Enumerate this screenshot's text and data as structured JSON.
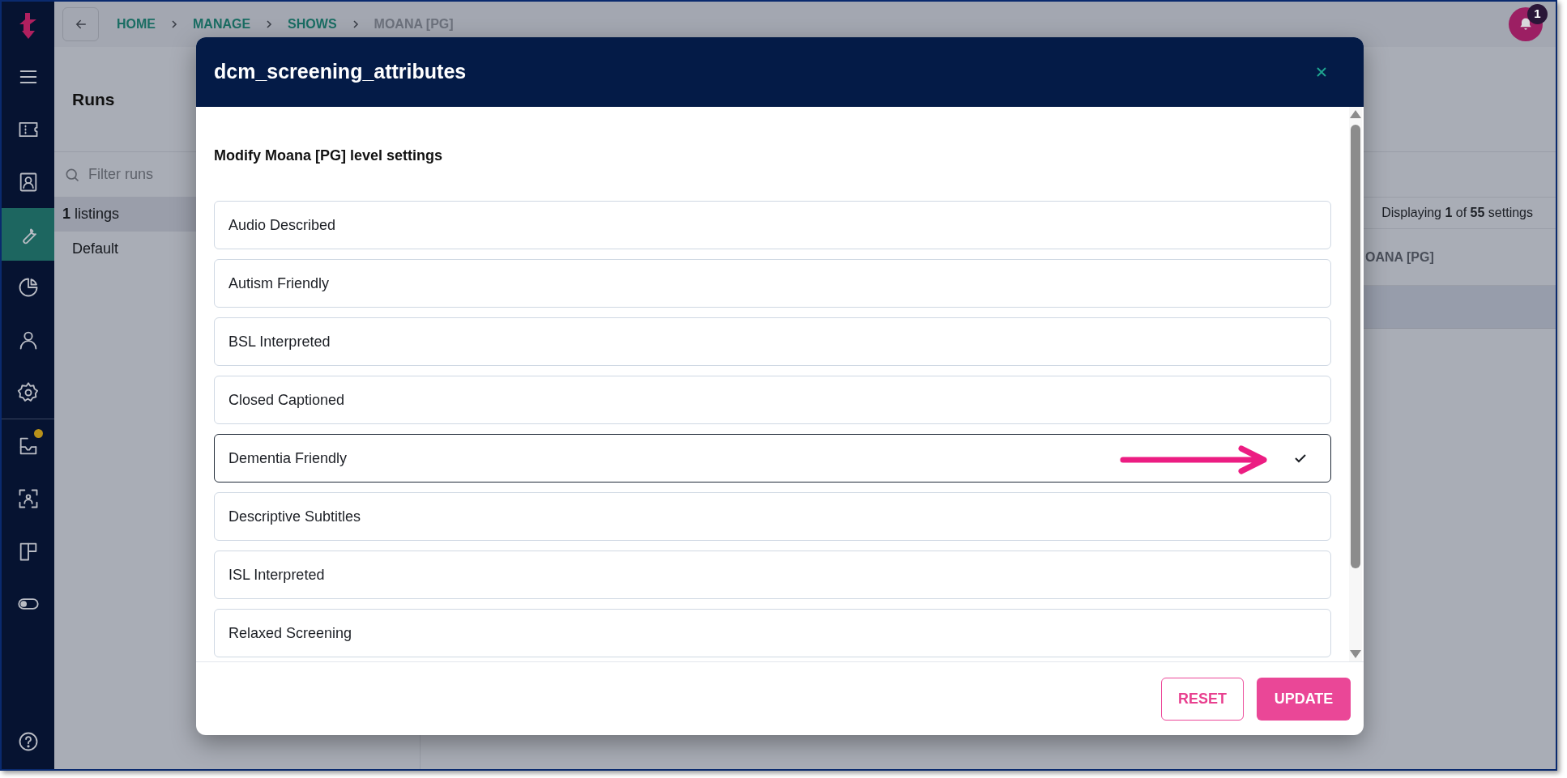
{
  "nav": {
    "items": [
      {
        "kind": "menu",
        "selected": false,
        "badge": false
      },
      {
        "kind": "ticket",
        "selected": false,
        "badge": false
      },
      {
        "kind": "contact",
        "selected": false,
        "badge": false
      },
      {
        "kind": "wrench",
        "selected": true,
        "badge": false
      },
      {
        "kind": "pie",
        "selected": false,
        "badge": false
      },
      {
        "kind": "person",
        "selected": false,
        "badge": false
      },
      {
        "kind": "gear",
        "selected": false,
        "badge": false
      },
      {
        "kind": "inbox",
        "selected": false,
        "badge": true
      },
      {
        "kind": "scan",
        "selected": false,
        "badge": false
      },
      {
        "kind": "layout",
        "selected": false,
        "badge": false
      },
      {
        "kind": "toggle",
        "selected": false,
        "badge": false
      }
    ]
  },
  "breadcrumb": [
    {
      "label": "HOME",
      "current": false
    },
    {
      "label": "MANAGE",
      "current": false
    },
    {
      "label": "SHOWS",
      "current": false
    },
    {
      "label": "MOANA [PG]",
      "current": true
    }
  ],
  "notifications": {
    "count": "1"
  },
  "runs": {
    "title": "Runs",
    "filter": {
      "placeholder": "Filter runs"
    },
    "items": [
      {
        "label": "**1** listings",
        "selected": true
      },
      {
        "label": "Default",
        "selected": false
      }
    ]
  },
  "settings": {
    "summary": "Displaying **1** of **55** settings",
    "column_1": "OANA [PG]"
  },
  "dialog": {
    "title": "dcm_screening_attributes",
    "subtitle": "Modify Moana [PG] level settings",
    "options": [
      {
        "label": "Audio Described",
        "selected": false
      },
      {
        "label": "Autism Friendly",
        "selected": false
      },
      {
        "label": "BSL Interpreted",
        "selected": false
      },
      {
        "label": "Closed Captioned",
        "selected": false
      },
      {
        "label": "Dementia Friendly",
        "selected": true
      },
      {
        "label": "Descriptive Subtitles",
        "selected": false
      },
      {
        "label": "ISL Interpreted",
        "selected": false
      },
      {
        "label": "Relaxed Screening",
        "selected": false
      }
    ],
    "buttons": [
      {
        "label": "RESET",
        "kind": "secondary"
      },
      {
        "label": "UPDATE",
        "kind": "primary"
      }
    ]
  }
}
